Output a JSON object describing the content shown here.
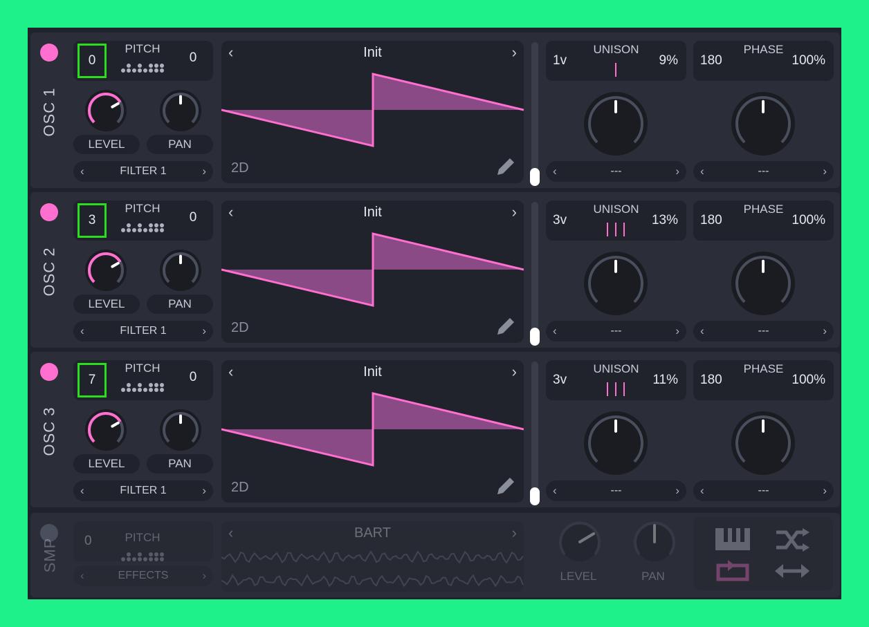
{
  "colors": {
    "accent": "#ff6fd0",
    "highlight": "#2bdd1e",
    "background": "#1ef08a"
  },
  "oscillators": [
    {
      "label": "OSC 1",
      "transpose": "0",
      "pitch_label": "PITCH",
      "tune": "0",
      "level_label": "LEVEL",
      "pan_label": "PAN",
      "level": 0.7,
      "filter": "FILTER 1",
      "wavetable": "Init",
      "dimension": "2D",
      "unison_voices": "1v",
      "unison_label": "UNISON",
      "unison_detune": "9%",
      "unison_ticks": 1,
      "phase": "180",
      "phase_label": "PHASE",
      "phase_random": "100%",
      "unison_dest": "---",
      "phase_dest": "---"
    },
    {
      "label": "OSC 2",
      "transpose": "3",
      "pitch_label": "PITCH",
      "tune": "0",
      "level_label": "LEVEL",
      "pan_label": "PAN",
      "level": 0.7,
      "filter": "FILTER 1",
      "wavetable": "Init",
      "dimension": "2D",
      "unison_voices": "3v",
      "unison_label": "UNISON",
      "unison_detune": "13%",
      "unison_ticks": 3,
      "phase": "180",
      "phase_label": "PHASE",
      "phase_random": "100%",
      "unison_dest": "---",
      "phase_dest": "---"
    },
    {
      "label": "OSC 3",
      "transpose": "7",
      "pitch_label": "PITCH",
      "tune": "0",
      "level_label": "LEVEL",
      "pan_label": "PAN",
      "level": 0.7,
      "filter": "FILTER 1",
      "wavetable": "Init",
      "dimension": "2D",
      "unison_voices": "3v",
      "unison_label": "UNISON",
      "unison_detune": "11%",
      "unison_ticks": 3,
      "phase": "180",
      "phase_label": "PHASE",
      "phase_random": "100%",
      "unison_dest": "---",
      "phase_dest": "---"
    }
  ],
  "sampler": {
    "label": "SMP",
    "transpose": "0",
    "pitch_label": "PITCH",
    "tune": "0",
    "sample": "BART",
    "effects": "EFFECTS",
    "level_label": "LEVEL",
    "pan_label": "PAN"
  },
  "icons": {
    "prev": "‹",
    "next": "›",
    "keyboard": "keyboard-icon",
    "random": "shuffle-icon",
    "loop": "loop-icon",
    "bounce": "bounce-icon",
    "edit": "pencil-icon"
  }
}
